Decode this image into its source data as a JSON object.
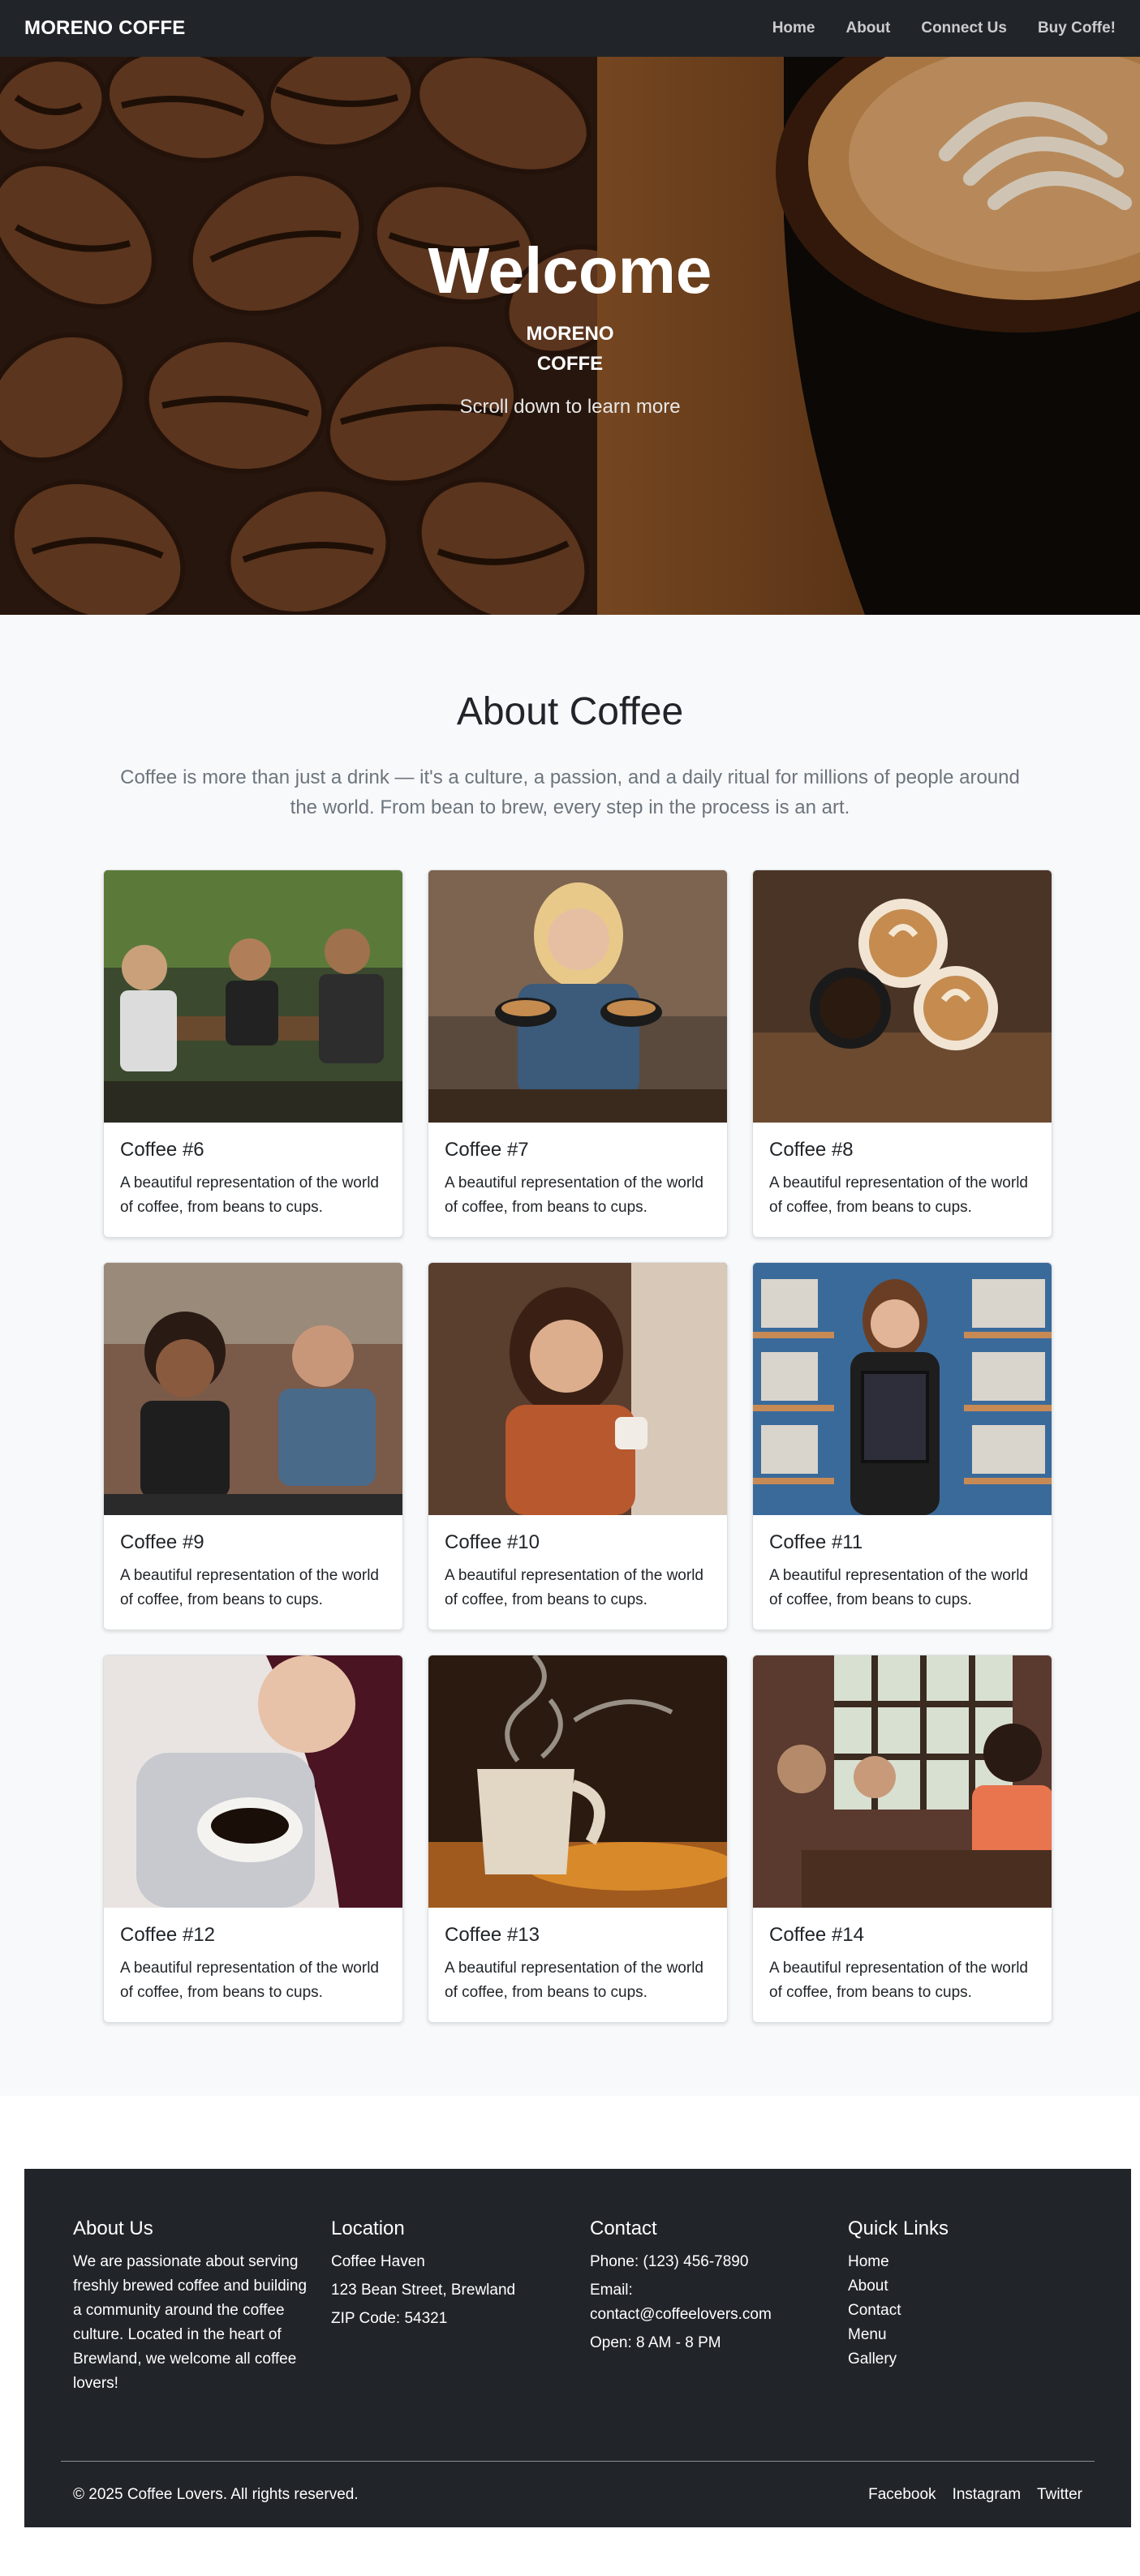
{
  "nav": {
    "brand": "MORENO COFFE",
    "links": [
      "Home",
      "About",
      "Connect Us",
      "Buy Coffe!"
    ]
  },
  "hero": {
    "title": "Welcome",
    "subtitle_line1": "MORENO",
    "subtitle_line2": "COFFE",
    "scroll_text": "Scroll down to learn more"
  },
  "about": {
    "title": "About Coffee",
    "lead": "Coffee is more than just a drink — it's a culture, a passion, and a daily ritual for millions of people around the world. From bean to brew, every step in the process is an art.",
    "cards": [
      {
        "title": "Coffee #6",
        "text": "A beautiful representation of the world of coffee, from beans to cups.",
        "image": "people-at-cafe-table-photo"
      },
      {
        "title": "Coffee #7",
        "text": "A beautiful representation of the world of coffee, from beans to cups.",
        "image": "woman-with-coffee-cups-photo"
      },
      {
        "title": "Coffee #8",
        "text": "A beautiful representation of the world of coffee, from beans to cups.",
        "image": "cups-toast-photo"
      },
      {
        "title": "Coffee #9",
        "text": "A beautiful representation of the world of coffee, from beans to cups.",
        "image": "friends-laughing-photo"
      },
      {
        "title": "Coffee #10",
        "text": "A beautiful representation of the world of coffee, from beans to cups.",
        "image": "woman-holding-cup-photo"
      },
      {
        "title": "Coffee #11",
        "text": "A beautiful representation of the world of coffee, from beans to cups.",
        "image": "woman-holding-certificate-photo"
      },
      {
        "title": "Coffee #12",
        "text": "A beautiful representation of the world of coffee, from beans to cups.",
        "image": "woman-smelling-coffee-photo"
      },
      {
        "title": "Coffee #13",
        "text": "A beautiful representation of the world of coffee, from beans to cups.",
        "image": "steaming-mug-photo"
      },
      {
        "title": "Coffee #14",
        "text": "A beautiful representation of the world of coffee, from beans to cups.",
        "image": "group-at-cafe-window-photo"
      }
    ]
  },
  "footer": {
    "about": {
      "heading": "About Us",
      "text": "We are passionate about serving freshly brewed coffee and building a community around the coffee culture. Located in the heart of Brewland, we welcome all coffee lovers!"
    },
    "location": {
      "heading": "Location",
      "lines": [
        "Coffee Haven",
        "123 Bean Street, Brewland",
        "ZIP Code: 54321"
      ]
    },
    "contact": {
      "heading": "Contact",
      "phone": "Phone: (123) 456-7890",
      "email": "Email: contact@coffeelovers.com",
      "hours": "Open: 8 AM - 8 PM"
    },
    "links": {
      "heading": "Quick Links",
      "items": [
        "Home",
        "About",
        "Contact",
        "Menu",
        "Gallery"
      ]
    },
    "copyright": "© 2025 Coffee Lovers. All rights reserved.",
    "social": [
      "Facebook",
      "Instagram",
      "Twitter"
    ]
  },
  "colors": {
    "nav_bg": "#212529",
    "section_bg": "#f8f9fa",
    "footer_bg": "#212529",
    "muted_text": "#6c757d"
  }
}
